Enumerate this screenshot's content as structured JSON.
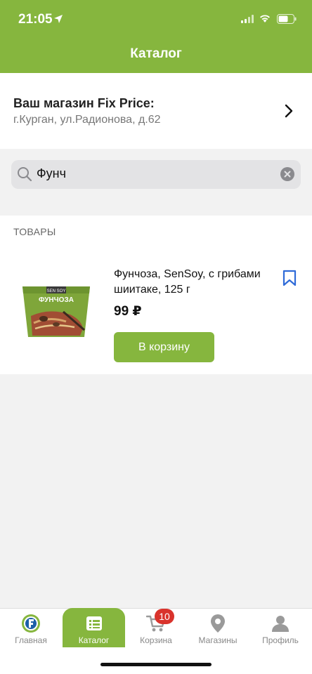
{
  "status_bar": {
    "time": "21:05"
  },
  "header": {
    "title": "Каталог"
  },
  "store": {
    "title": "Ваш магазин Fix Price:",
    "address": "г.Курган, ул.Радионова, д.62"
  },
  "search": {
    "value": "Фунч"
  },
  "products": {
    "section_label": "ТОВАРЫ",
    "items": [
      {
        "name": "Фунчоза, SenSoy, с грибами шиитаке, 125 г",
        "price": "99 ₽",
        "add_label": "В корзину",
        "package_brand": "SEN SOY",
        "package_name": "ФУНЧОЗА"
      }
    ]
  },
  "tabbar": {
    "items": [
      {
        "label": "Главная",
        "icon": "fixprice-logo-icon"
      },
      {
        "label": "Каталог",
        "icon": "catalog-icon",
        "active": true
      },
      {
        "label": "Корзина",
        "icon": "cart-icon",
        "badge": "10"
      },
      {
        "label": "Магазины",
        "icon": "map-pin-icon"
      },
      {
        "label": "Профиль",
        "icon": "profile-icon"
      }
    ]
  },
  "colors": {
    "brand_green": "#86b63e",
    "badge_red": "#d9332c",
    "bookmark_blue": "#2f6bd8"
  }
}
